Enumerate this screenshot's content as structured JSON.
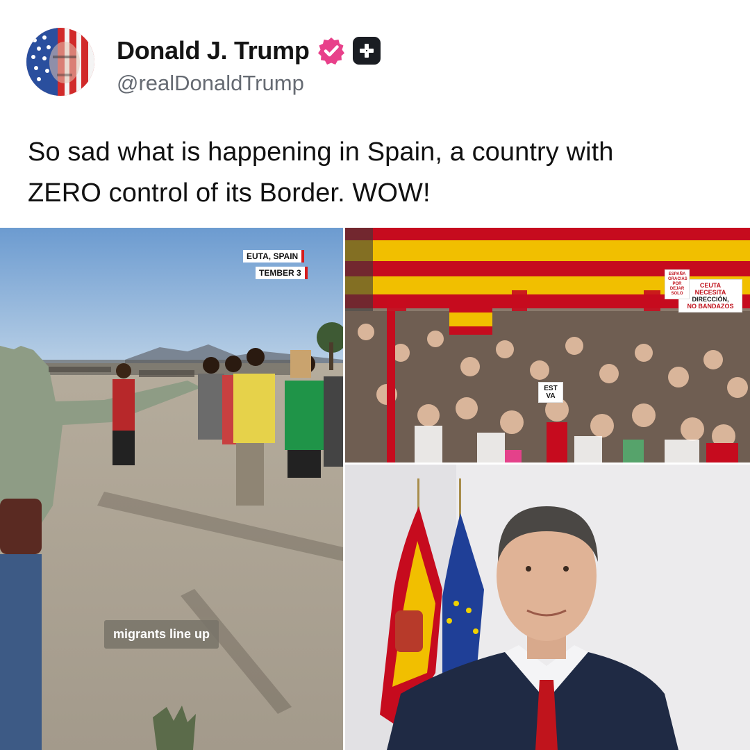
{
  "profile": {
    "name": "Donald J. Trump",
    "handle": "@realDonaldTrump",
    "avatar_icon": "flag-portrait-avatar",
    "verified_icon": "verified-badge-icon",
    "plus_icon": "plus-badge-icon"
  },
  "post": {
    "text_line1": "So sad what is happening in Spain, a country with",
    "text_line2": "ZERO control of its Border. WOW!"
  },
  "media": {
    "left": {
      "location_tag": "EUTA, SPAIN",
      "date_tag": "TEMBER 3",
      "caption": "migrants line up"
    },
    "top_right": {
      "sign_main_line1": "CEUTA",
      "sign_main_line2": "NECESITA",
      "sign_main_line3": "DIRECCIÓN,",
      "sign_main_line4": "NO BANDAZOS",
      "sign_small_line1": "ESPAÑA",
      "sign_small_line2": "GRACIAS",
      "sign_small_line3": "POR",
      "sign_small_line4": "DEJAR",
      "sign_small_line5": "SOLO",
      "sign_tiny_line1": "EST",
      "sign_tiny_line2": "VA"
    }
  },
  "colors": {
    "verified": "#e8408a",
    "spain_red": "#c60b1e",
    "spain_yellow": "#f1bf00",
    "eu_blue": "#1f3f97"
  }
}
